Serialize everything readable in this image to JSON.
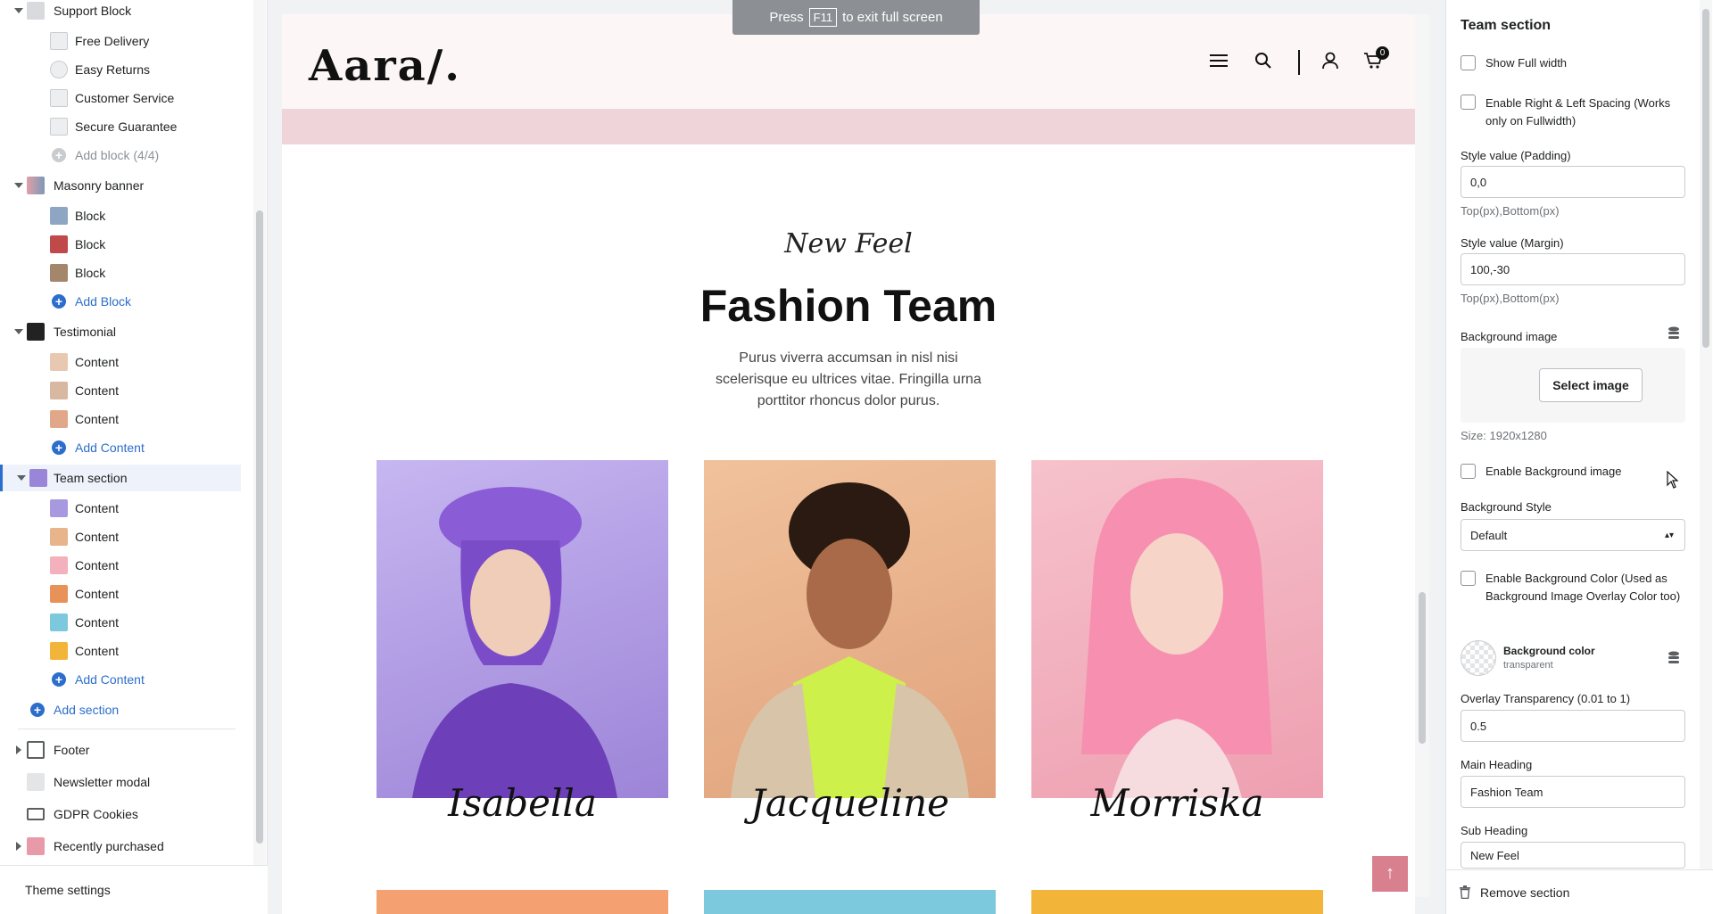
{
  "fullscreen_hint": {
    "press": "Press",
    "key": "F11",
    "rest": "to exit full screen"
  },
  "sidebar": {
    "support_block": "Support Block",
    "support_items": [
      "Free Delivery",
      "Easy Returns",
      "Customer Service",
      "Secure Guarantee"
    ],
    "support_add": "Add block (4/4)",
    "masonry": "Masonry banner",
    "masonry_items": [
      "Block",
      "Block",
      "Block"
    ],
    "masonry_add": "Add Block",
    "testimonial": "Testimonial",
    "testimonial_items": [
      "Content",
      "Content",
      "Content"
    ],
    "testimonial_add": "Add Content",
    "team": "Team section",
    "team_items": [
      "Content",
      "Content",
      "Content",
      "Content",
      "Content",
      "Content"
    ],
    "team_add": "Add Content",
    "add_section": "Add section",
    "footer": "Footer",
    "newsletter": "Newsletter modal",
    "gdpr": "GDPR Cookies",
    "recently": "Recently purchased",
    "theme_settings": "Theme settings"
  },
  "preview": {
    "logo": "Aara/.",
    "cart_count": "0",
    "sub_heading": "New Feel",
    "main_heading": "Fashion Team",
    "description": "Purus viverra accumsan in nisl nisi scelerisque eu ultrices vitae. Fringilla urna porttitor rhoncus dolor purus.",
    "members": [
      {
        "name": "Isabella",
        "color": "#b9a6e8"
      },
      {
        "name": "Jacqueline",
        "color": "#e8b48c"
      },
      {
        "name": "Morriska",
        "color": "#f3b0bd"
      }
    ],
    "bottom_colors": [
      "#f4a070",
      "#7cc8dc",
      "#f2b53a"
    ]
  },
  "settings": {
    "title": "Team section",
    "show_full_width": "Show Full width",
    "enable_spacing": "Enable Right & Left Spacing (Works only on Fullwidth)",
    "padding_label": "Style value (Padding)",
    "padding_value": "0,0",
    "padding_help": "Top(px),Bottom(px)",
    "margin_label": "Style value (Margin)",
    "margin_value": "100,-30",
    "margin_help": "Top(px),Bottom(px)",
    "bg_image_label": "Background image",
    "select_image": "Select image",
    "size": "Size: 1920x1280",
    "enable_bg_image": "Enable Background image",
    "bg_style_label": "Background Style",
    "bg_style_value": "Default",
    "enable_bg_color": "Enable Background Color (Used as Background Image Overlay Color too)",
    "bg_color_label": "Background color",
    "bg_color_value": "transparent",
    "overlay_label": "Overlay Transparency (0.01 to 1)",
    "overlay_value": "0.5",
    "main_heading_label": "Main Heading",
    "main_heading_value": "Fashion Team",
    "sub_heading_label": "Sub Heading",
    "sub_heading_value": "New Feel",
    "remove": "Remove section"
  }
}
